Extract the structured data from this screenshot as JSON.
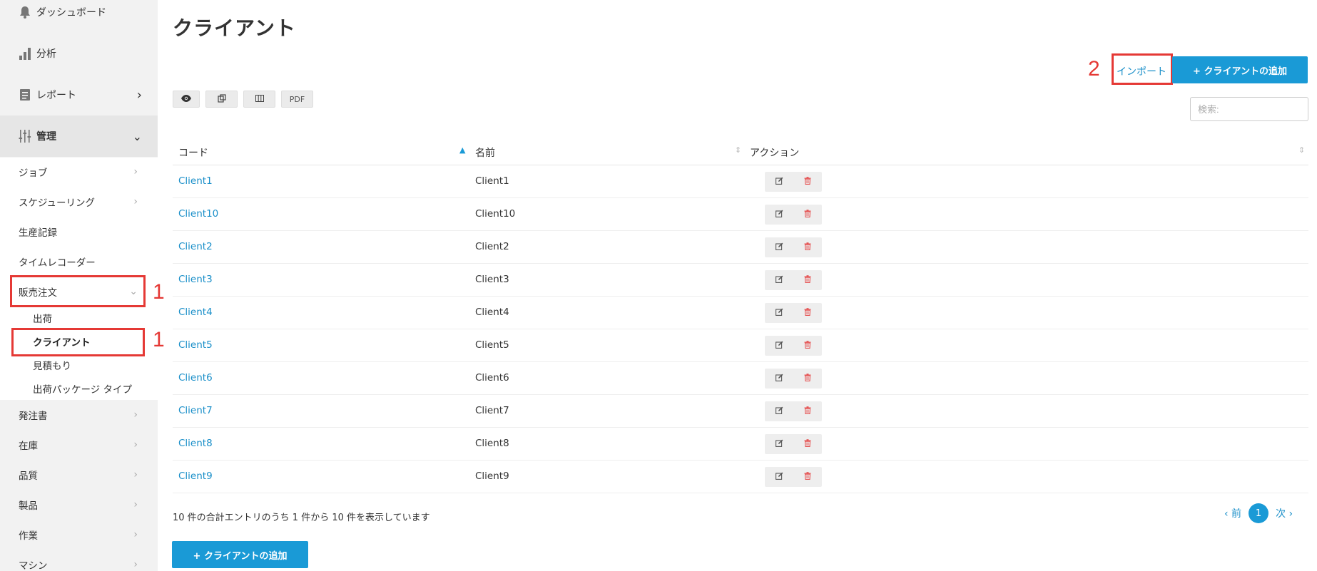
{
  "sidebar": {
    "top_items": [
      {
        "label": "ダッシュボード",
        "icon": "bell-icon"
      },
      {
        "label": "分析",
        "icon": "bar-chart-icon"
      },
      {
        "label": "レポート",
        "icon": "document-icon",
        "chevron": "›"
      },
      {
        "label": "管理",
        "icon": "sliders-icon",
        "chevron": "⌄"
      }
    ],
    "sub_items": [
      {
        "label": "ジョブ",
        "chevron": "›"
      },
      {
        "label": "スケジューリング",
        "chevron": "›"
      },
      {
        "label": "生産記録"
      },
      {
        "label": "タイムレコーダー"
      },
      {
        "label": "販売注文",
        "chevron": "⌄"
      }
    ],
    "sales_children": [
      "出荷",
      "クライアント",
      "見積もり",
      "出荷パッケージ タイプ"
    ],
    "bottom_items": [
      "発注書",
      "在庫",
      "品質",
      "製品",
      "作業",
      "マシン"
    ],
    "chevron": "›"
  },
  "annotations": [
    "1",
    "1",
    "2"
  ],
  "page": {
    "title": "クライアント",
    "import_label": "インポート",
    "add_label": "+ クライアントの追加",
    "search_placeholder": "検索:"
  },
  "toolbar": {
    "view_icon": "eye-icon",
    "copy_icon": "copy-icon",
    "columns_icon": "columns-icon",
    "pdf_label": "PDF"
  },
  "table": {
    "headers": [
      "コード",
      "名前",
      "アクション"
    ],
    "rows": [
      {
        "code": "Client1",
        "name": "Client1"
      },
      {
        "code": "Client10",
        "name": "Client10"
      },
      {
        "code": "Client2",
        "name": "Client2"
      },
      {
        "code": "Client3",
        "name": "Client3"
      },
      {
        "code": "Client4",
        "name": "Client4"
      },
      {
        "code": "Client5",
        "name": "Client5"
      },
      {
        "code": "Client6",
        "name": "Client6"
      },
      {
        "code": "Client7",
        "name": "Client7"
      },
      {
        "code": "Client8",
        "name": "Client8"
      },
      {
        "code": "Client9",
        "name": "Client9"
      }
    ]
  },
  "footer": {
    "info": "10 件の合計エントリのうち 1 件から 10 件を表示しています",
    "prev": "‹ 前",
    "page": "1",
    "next": "次 ›"
  },
  "colors": {
    "accent": "#1a9ad6",
    "link": "#1a8fc9",
    "annotation": "#e53935",
    "delete": "#e55353"
  }
}
